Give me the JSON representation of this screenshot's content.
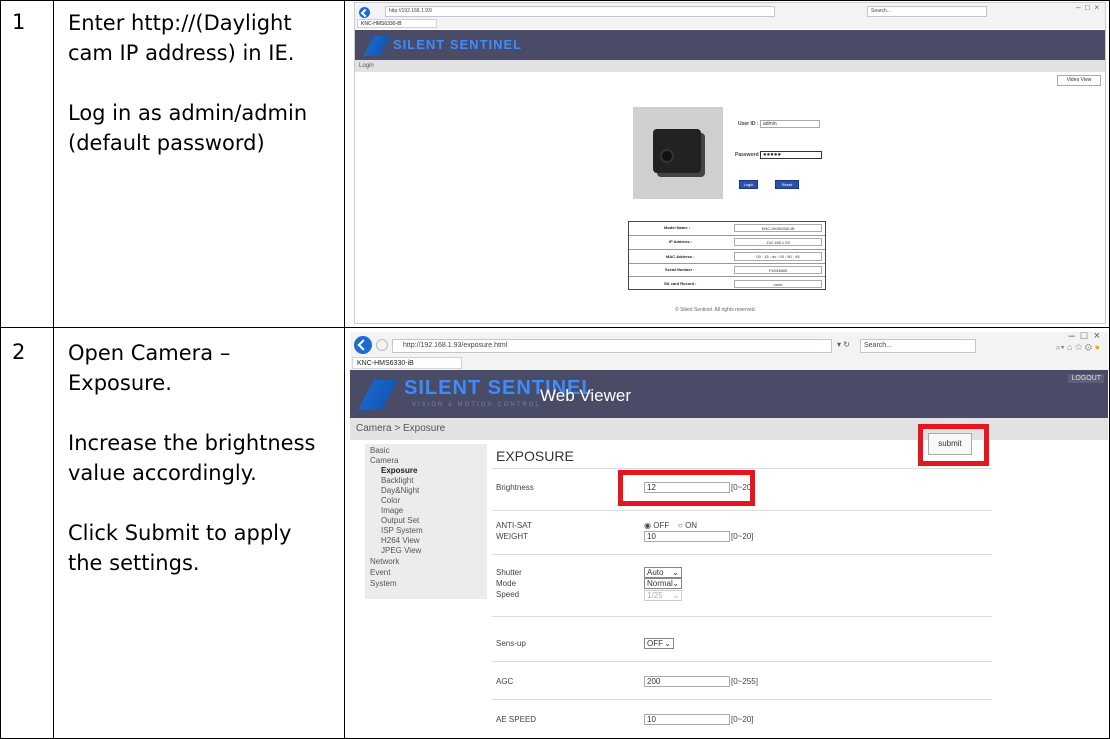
{
  "rows": [
    {
      "number": "1",
      "paragraphs": [
        "Enter http://(Daylight cam IP address) in IE.",
        "Log in as admin/admin (default password)"
      ]
    },
    {
      "number": "2",
      "paragraphs": [
        "Open Camera – Exposure.",
        "Increase the brightness value accordingly.",
        "Click Submit to apply the settings."
      ]
    }
  ],
  "shot1": {
    "url": "http://192.168.1.93/",
    "search_placeholder": "Search...",
    "tab_title": "KNC-HMS6330-iB",
    "logo": "SILENT SENTINEL",
    "breadcrumb": "Login",
    "video_view": "Video View",
    "user_id_label": "User ID :",
    "user_id_value": "admin",
    "password_label": "Password :",
    "password_value": "●●●●●",
    "login_button": "Login",
    "reset_button": "Reset",
    "info": [
      {
        "label": "Model Name :",
        "value": "KNC-HMS6330-iB"
      },
      {
        "label": "IP Address :",
        "value": "192.168.1.93"
      },
      {
        "label": "MAC Address :",
        "value": "00 : 15 : dc : 00 : 80 : 45"
      },
      {
        "label": "Serial Number :",
        "value": "F4034885"
      },
      {
        "label": "SD card Record :",
        "value": "none"
      }
    ],
    "footer": "© Silent Sentinel. All rights reserved."
  },
  "shot2": {
    "url": "http://192.168.1.93/exposure.html",
    "search_placeholder": "Search...",
    "tab_title": "KNC-HMS6330-iB",
    "logo": "SILENT SENTINEL",
    "logo_sub": "VISION & MOTION CONTROL",
    "web_viewer": "Web Viewer",
    "logout": "LOGOUT",
    "breadcrumb": "Camera > Exposure",
    "menu": [
      "Basic",
      "Camera"
    ],
    "submenu": [
      "Exposure",
      "Backlight",
      "Day&Night",
      "Color",
      "Image",
      "Output Set",
      "ISP System",
      "H264 View",
      "JPEG View"
    ],
    "menu2": [
      "Network",
      "Event",
      "System"
    ],
    "section_title": "EXPOSURE",
    "submit": "submit",
    "brightness_label": "Brightness",
    "brightness_value": "12",
    "brightness_range": "[0~20]",
    "antisat_label": "ANTI-SAT",
    "antisat_off": "OFF",
    "antisat_on": "ON",
    "weight_label": "WEIGHT",
    "weight_value": "10",
    "weight_range": "[0~20]",
    "shutter_label": "Shutter",
    "shutter_value": "Auto",
    "mode_label": "Mode",
    "mode_value": "Normal",
    "speed_label": "Speed",
    "speed_value": "1/25",
    "sensup_label": "Sens-up",
    "sensup_value": "OFF",
    "agc_label": "AGC",
    "agc_value": "200",
    "agc_range": "[0~255]",
    "aespeed_label": "AE SPEED",
    "aespeed_value": "10",
    "aespeed_range": "[0~20]"
  },
  "colors": {
    "highlight": "#e8141e",
    "banner": "#4a4c67",
    "ie_back": "#1e6bd6"
  }
}
